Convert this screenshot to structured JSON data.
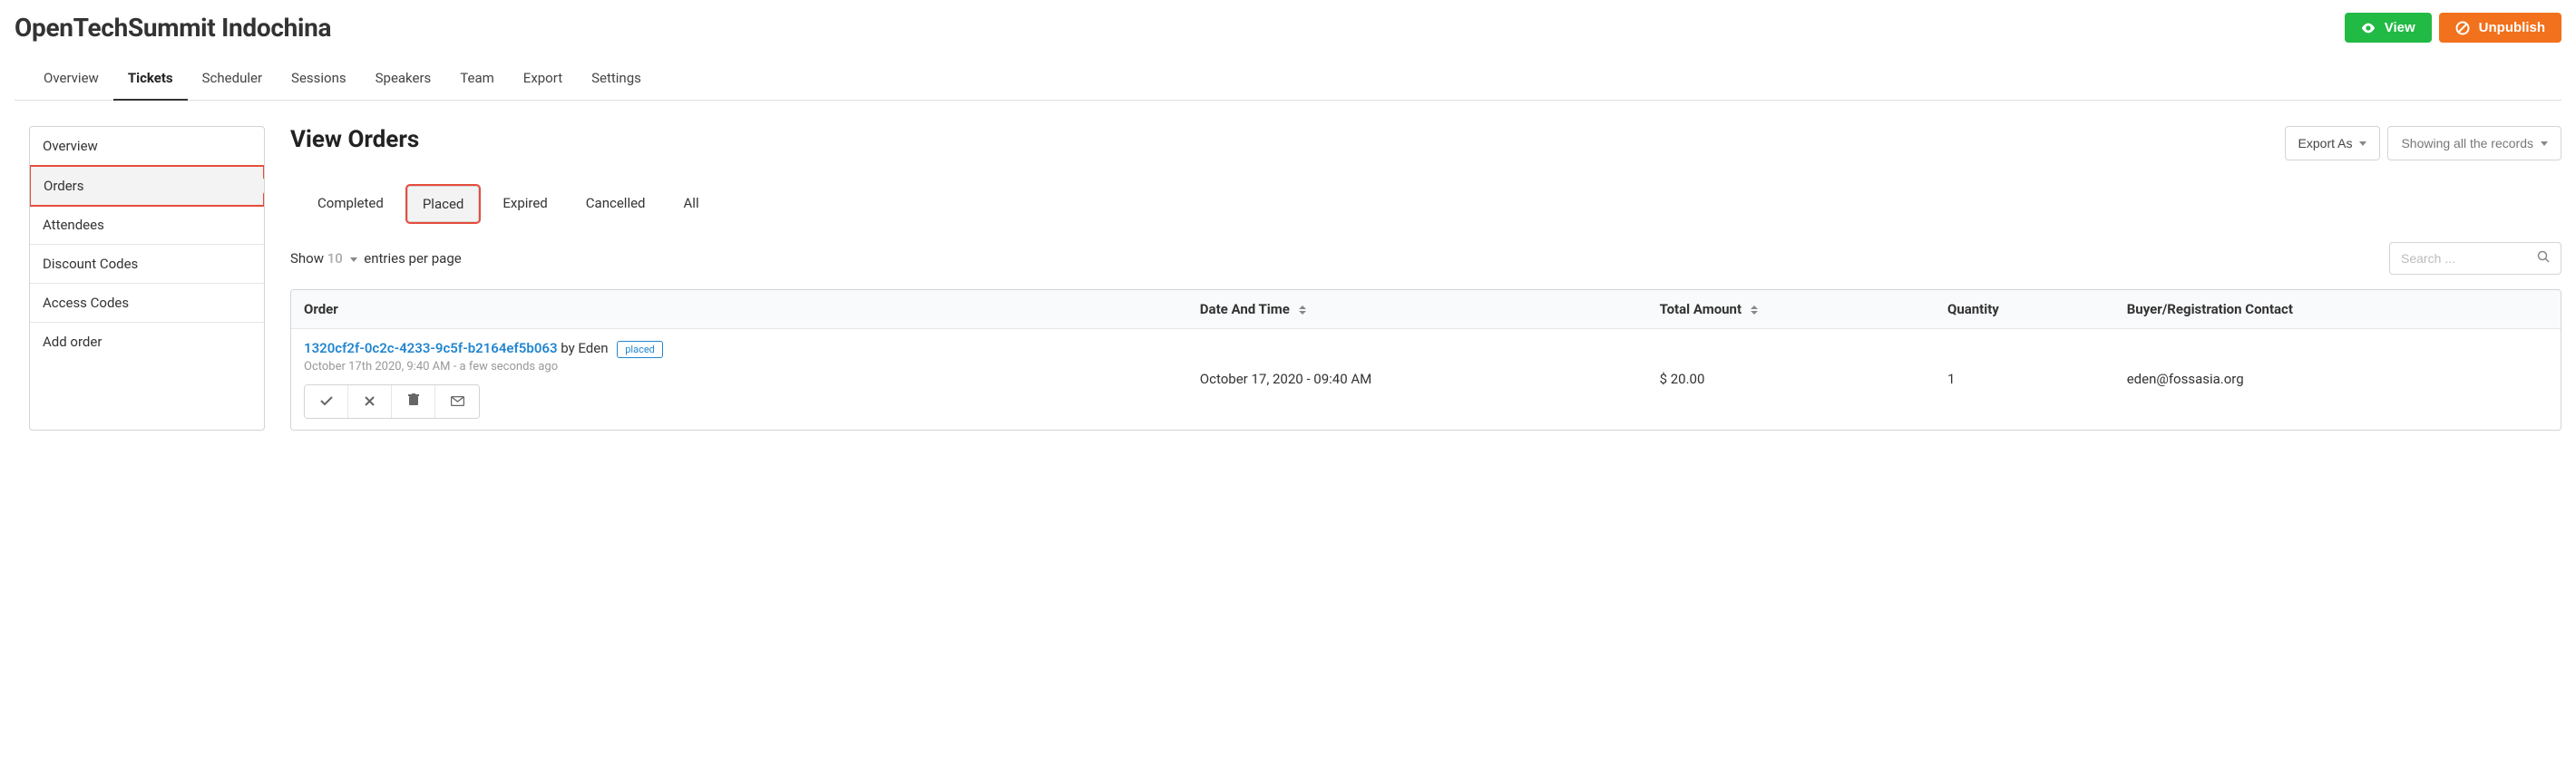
{
  "header": {
    "title": "OpenTechSummit Indochina",
    "view_btn": "View",
    "unpublish_btn": "Unpublish"
  },
  "nav": {
    "tabs": [
      "Overview",
      "Tickets",
      "Scheduler",
      "Sessions",
      "Speakers",
      "Team",
      "Export",
      "Settings"
    ],
    "active": "Tickets"
  },
  "sidebar": {
    "items": [
      "Overview",
      "Orders",
      "Attendees",
      "Discount Codes",
      "Access Codes",
      "Add order"
    ],
    "active": "Orders"
  },
  "main": {
    "title": "View Orders",
    "export_btn": "Export As",
    "filter_btn": "Showing all the records",
    "sub_tabs": [
      "Completed",
      "Placed",
      "Expired",
      "Cancelled",
      "All"
    ],
    "sub_tab_active": "Placed",
    "entries": {
      "prefix": "Show",
      "count": "10",
      "suffix": "entries per page"
    },
    "search_placeholder": "Search ...",
    "columns": {
      "order": "Order",
      "date": "Date And Time",
      "amount": "Total Amount",
      "quantity": "Quantity",
      "buyer": "Buyer/Registration Contact"
    },
    "rows": [
      {
        "order_id": "1320cf2f-0c2c-4233-9c5f-b2164ef5b063",
        "by": "by Eden",
        "status": "placed",
        "meta": "October 17th 2020, 9:40 AM - a few seconds ago",
        "date": "October 17, 2020 - 09:40 AM",
        "amount": "$ 20.00",
        "quantity": "1",
        "buyer": "eden@fossasia.org"
      }
    ]
  }
}
